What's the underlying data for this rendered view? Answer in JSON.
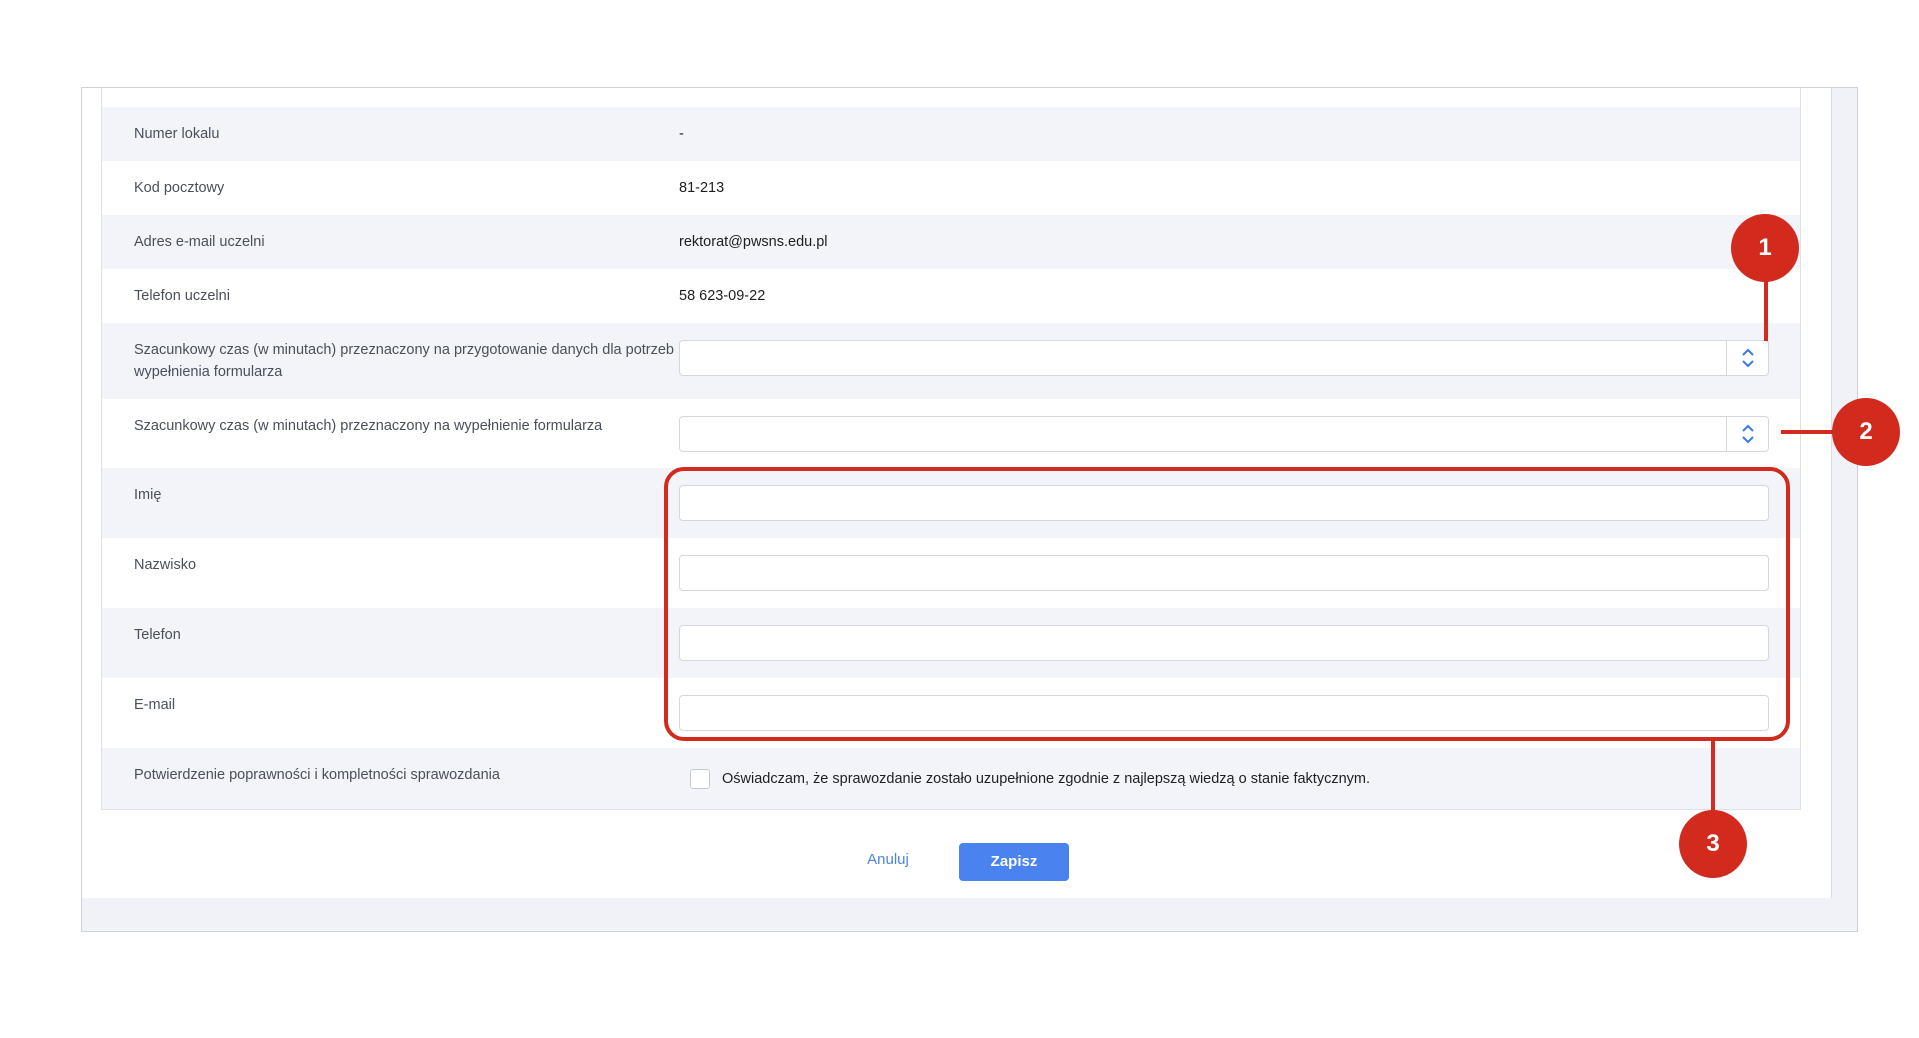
{
  "rows": [
    {
      "label": "Numer lokalu",
      "value": "-"
    },
    {
      "label": "Kod pocztowy",
      "value": "81-213"
    },
    {
      "label": "Adres e-mail uczelni",
      "value": "rektorat@pwsns.edu.pl"
    },
    {
      "label": "Telefon uczelni",
      "value": "58 623-09-22"
    }
  ],
  "numeric_fields": [
    {
      "label": "Szacunkowy czas (w minutach) przeznaczony na przygotowanie danych dla potrzeb wypełnienia formularza",
      "value": ""
    },
    {
      "label": "Szacunkowy czas (w minutach) przeznaczony na wypełnienie formularza",
      "value": ""
    }
  ],
  "text_fields": [
    {
      "label": "Imię",
      "value": ""
    },
    {
      "label": "Nazwisko",
      "value": ""
    },
    {
      "label": "Telefon",
      "value": ""
    },
    {
      "label": "E-mail",
      "value": ""
    }
  ],
  "confirmation": {
    "label": "Potwierdzenie poprawności i kompletności sprawozdania",
    "checkbox_text": "Oświadczam, że sprawozdanie zostało uzupełnione zgodnie z najlepszą wiedzą o stanie faktycznym.",
    "checked": false
  },
  "actions": {
    "cancel": "Anuluj",
    "save": "Zapisz"
  },
  "callouts": [
    "1",
    "2",
    "3"
  ],
  "colors": {
    "accent": "#4a82ef",
    "callout": "#d22b1e"
  }
}
